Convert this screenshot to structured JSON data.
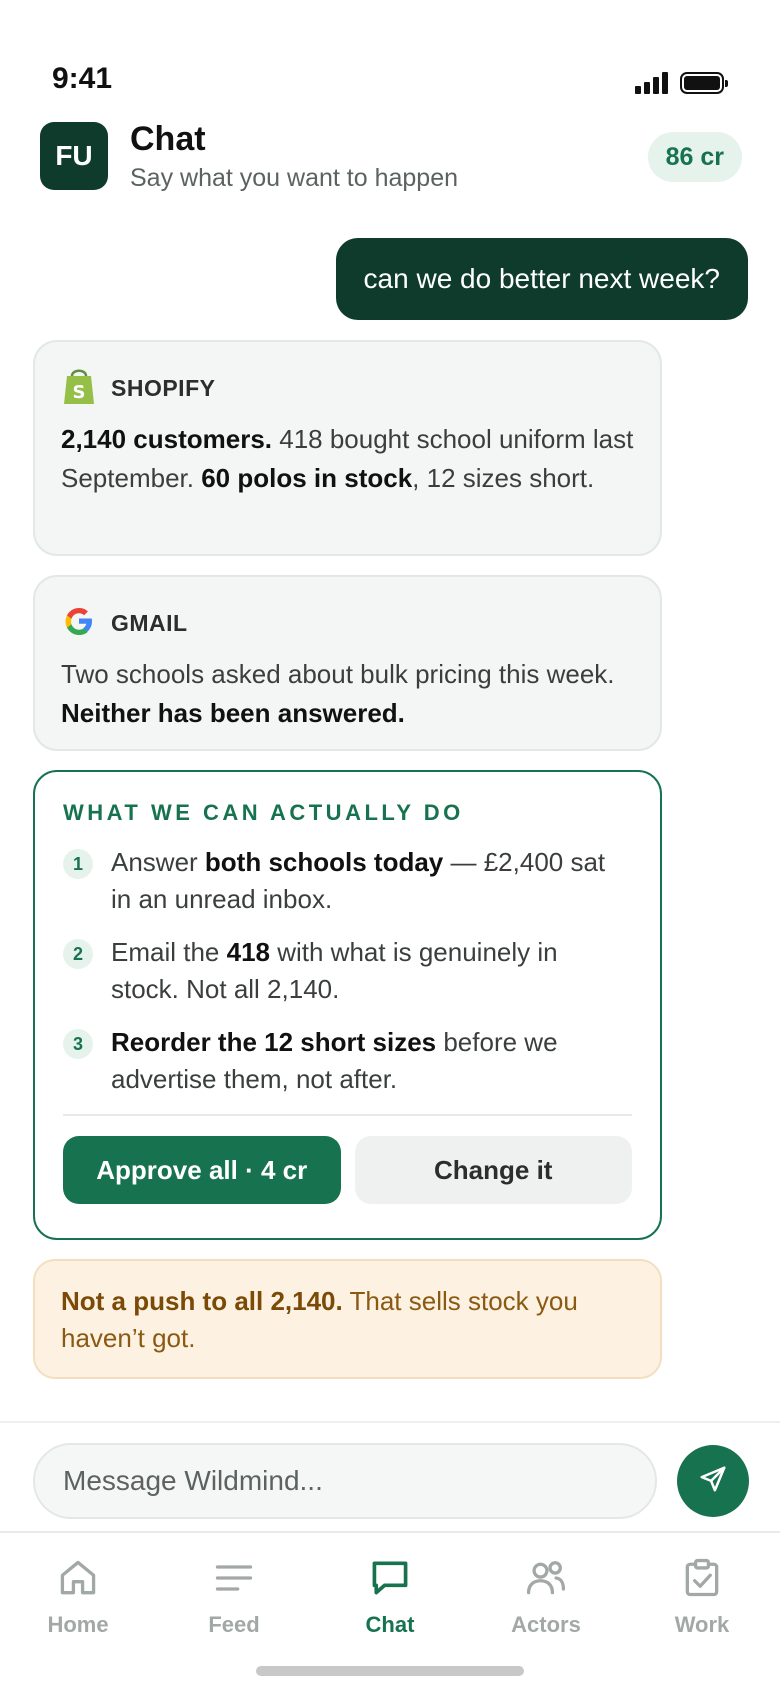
{
  "status_bar": {
    "time": "9:41"
  },
  "header": {
    "avatar_initials": "FU",
    "title": "Chat",
    "subtitle": "Say what you want to happen",
    "credits": "86 cr"
  },
  "messages": {
    "user": "can we do better next week?"
  },
  "shopify_card": {
    "source": "SHOPIFY",
    "bold1": "2,140 customers.",
    "text1": " 418 bought school uniform last September. ",
    "bold2": "60 polos in stock",
    "text2": ", 12 sizes short."
  },
  "gmail_card": {
    "source": "GMAIL",
    "text1": "Two schools asked about bulk pricing this week. ",
    "bold1": "Neither has been answered."
  },
  "action_card": {
    "heading": "WHAT WE CAN ACTUALLY DO",
    "steps": [
      {
        "num": "1",
        "pre": "Answer ",
        "bold": "both schools today",
        "post": " — £2,400 sat in an unread inbox."
      },
      {
        "num": "2",
        "pre": "Email the ",
        "bold": "418",
        "post": " with what is genuinely in stock. Not all 2,140."
      },
      {
        "num": "3",
        "pre": "",
        "bold": "Reorder the 12 short sizes",
        "post": " before we advertise them, not after."
      }
    ],
    "approve_label": "Approve all · 4 cr",
    "change_label": "Change it"
  },
  "warning_card": {
    "bold": "Not a push to all 2,140.",
    "text": " That sells stock you haven’t got."
  },
  "composer": {
    "placeholder": "Message Wildmind..."
  },
  "tabs": [
    {
      "label": "Home",
      "icon": "home-icon",
      "active": false
    },
    {
      "label": "Feed",
      "icon": "feed-icon",
      "active": false
    },
    {
      "label": "Chat",
      "icon": "chat-icon",
      "active": true
    },
    {
      "label": "Actors",
      "icon": "actors-icon",
      "active": false
    },
    {
      "label": "Work",
      "icon": "work-icon",
      "active": false
    }
  ],
  "colors": {
    "brand_dark": "#0e3b2c",
    "brand_green": "#17734f",
    "card_bg": "#f3f6f5",
    "warning_bg": "#fdf1e2",
    "warning_text": "#8a5a12",
    "inactive_tab": "#a2a8a5"
  }
}
